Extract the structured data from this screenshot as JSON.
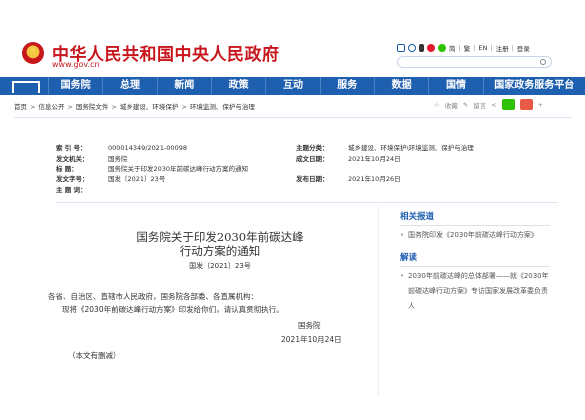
{
  "header": {
    "site_title": "中华人民共和国中央人民政府",
    "site_url": "www.gov.cn",
    "links": [
      "简",
      "繁",
      "EN",
      "注册",
      "登录"
    ]
  },
  "nav": {
    "items": [
      "国务院",
      "总理",
      "新闻",
      "政策",
      "互动",
      "服务",
      "数据",
      "国情",
      "国家政务服务平台"
    ]
  },
  "breadcrumb": {
    "items": [
      "首页",
      "信息公开",
      "国务院文件",
      "城乡建设、环境保护",
      "环境监测、保护与治理"
    ],
    "tools": [
      "收藏",
      "留言"
    ]
  },
  "info": {
    "index_label": "索 引 号：",
    "index_value": "000014349/2021-00098",
    "category_label": "主题分类：",
    "category_value": "城乡建设、环境保护\\环境监测、保护与治理",
    "issuer_label": "发文机关：",
    "issuer_value": "国务院",
    "created_label": "成文日期：",
    "created_value": "2021年10月24日",
    "title_label": "标 题：",
    "title_value": "国务院关于印发2030年前碳达峰行动方案的通知",
    "docnum_label": "发文字号：",
    "docnum_value": "国发〔2021〕23号",
    "published_label": "发布日期：",
    "published_value": "2021年10月26日",
    "keywords_label": "主 题 词：",
    "keywords_value": ""
  },
  "article": {
    "title_line1": "国务院关于印发2030年前碳达峰",
    "title_line2": "行动方案的通知",
    "doc_number": "国发〔2021〕23号",
    "paragraph1": "各省、自治区、直辖市人民政府，国务院各部委、各直属机构：",
    "paragraph2": "现将《2030年前碳达峰行动方案》印发给你们，请认真贯彻执行。",
    "sign_org": "国务院",
    "sign_date": "2021年10月24日",
    "note": "（本文有删减）"
  },
  "sidebar": {
    "related_head": "相关报道",
    "related_items": [
      "国务院印发《2030年前碳达峰行动方案》"
    ],
    "interpret_head": "解读",
    "interpret_items": [
      "2030年前碳达峰的总体部署——就《2030年前碳达峰行动方案》专访国家发展改革委负责人"
    ]
  }
}
